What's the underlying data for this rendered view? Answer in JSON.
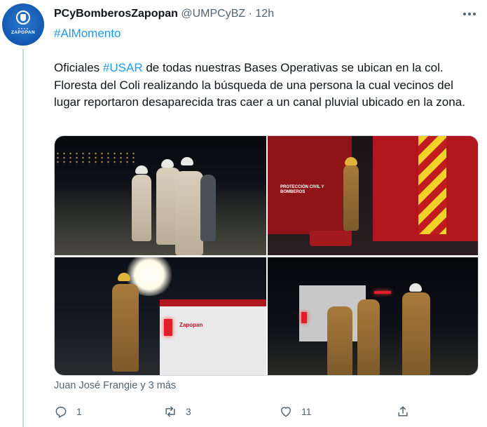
{
  "tweet": {
    "author": {
      "display_name": "PCyBomberosZapopan",
      "handle": "@UMPCyBZ",
      "separator": "·",
      "time": "12h",
      "avatar_text": "ZAPOPAN"
    },
    "hashtag_line": "#AlMomento",
    "text_parts": {
      "pre": "Oficiales ",
      "tag": "#USAR",
      "post": " de todas nuestras Bases Operativas se ubican en la col. Floresta del Coli realizando la búsqueda de una persona la cual vecinos del lugar reportaron desaparecida tras caer a un canal pluvial ubicado en la zona."
    },
    "media": {
      "photo2_text": "PROTECCIÓN CIVIL Y BOMBEROS",
      "photo3_text": "Zapopan"
    },
    "liked_by": "Juan José Frangie y 3 más",
    "actions": {
      "reply_icon": "reply-icon",
      "reply_count": "1",
      "retweet_icon": "retweet-icon",
      "retweet_count": "3",
      "like_icon": "heart-icon",
      "like_count": "11",
      "share_icon": "share-icon"
    }
  },
  "colors": {
    "accent": "#1d9bf0",
    "text": "#0f1419",
    "secondary": "#536471",
    "avatar_blue": "#1458b0"
  }
}
